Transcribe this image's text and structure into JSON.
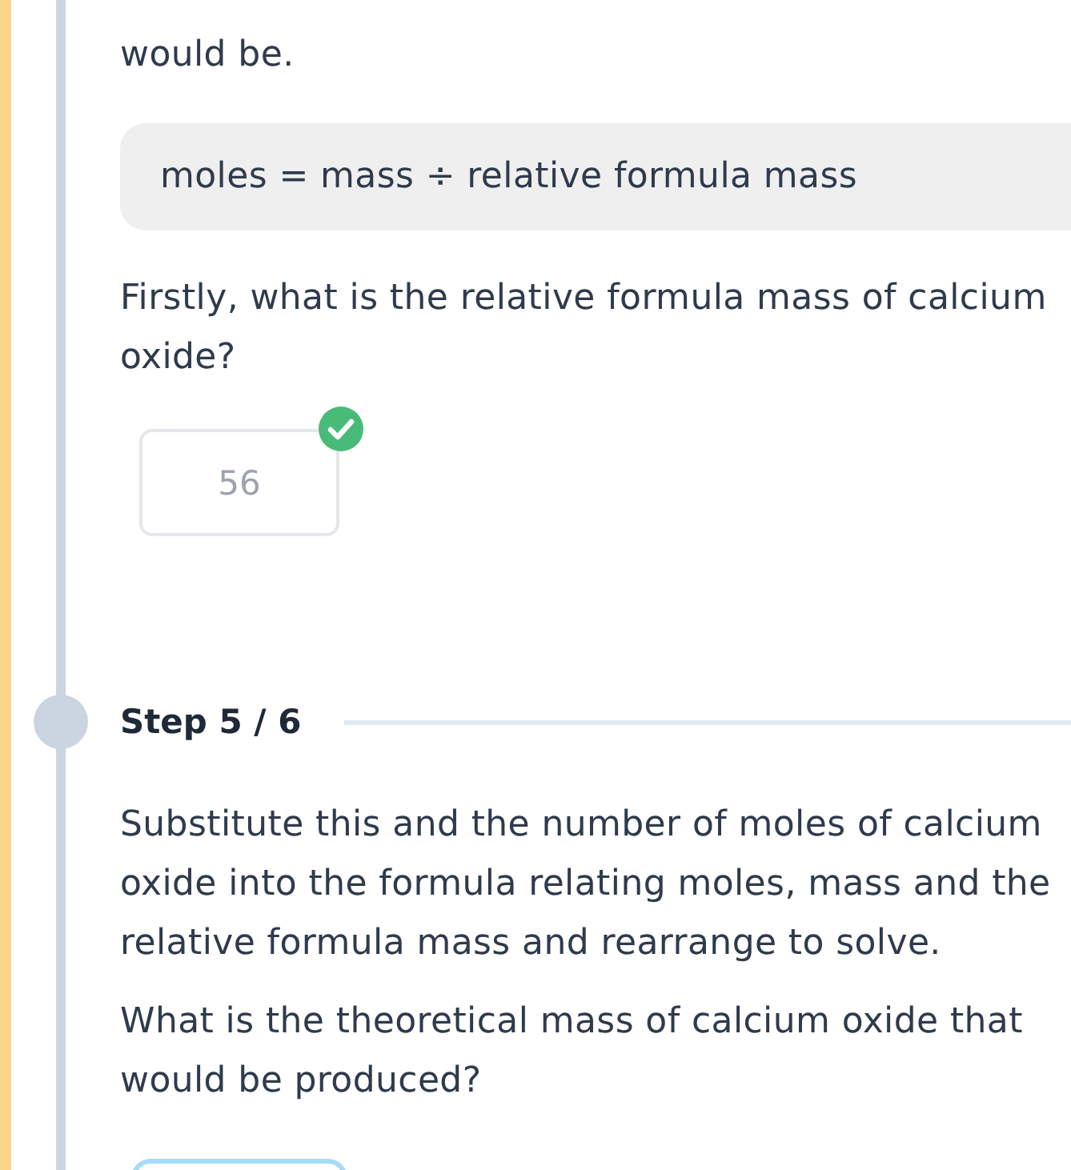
{
  "steps": [
    {
      "blocks": [
        {
          "kind": "text",
          "text": "would be."
        },
        {
          "kind": "formula",
          "text": "moles = mass ÷ relative formula mass"
        },
        {
          "kind": "text",
          "text": "Firstly, what is the relative formula mass of calcium oxide?"
        },
        {
          "kind": "answer",
          "value": "56",
          "correct": true,
          "focused": false
        }
      ]
    },
    {
      "label": "Step 5 / 6",
      "blocks": [
        {
          "kind": "text",
          "text": "Substitute this and the number of moles of calcium oxide into the formula relating moles, mass and the relative formula mass and rearrange to solve."
        },
        {
          "kind": "text",
          "text": "What is the theoretical mass of calcium oxide that would be produced?"
        },
        {
          "kind": "answer",
          "correct": false,
          "focused": true
        }
      ]
    }
  ]
}
